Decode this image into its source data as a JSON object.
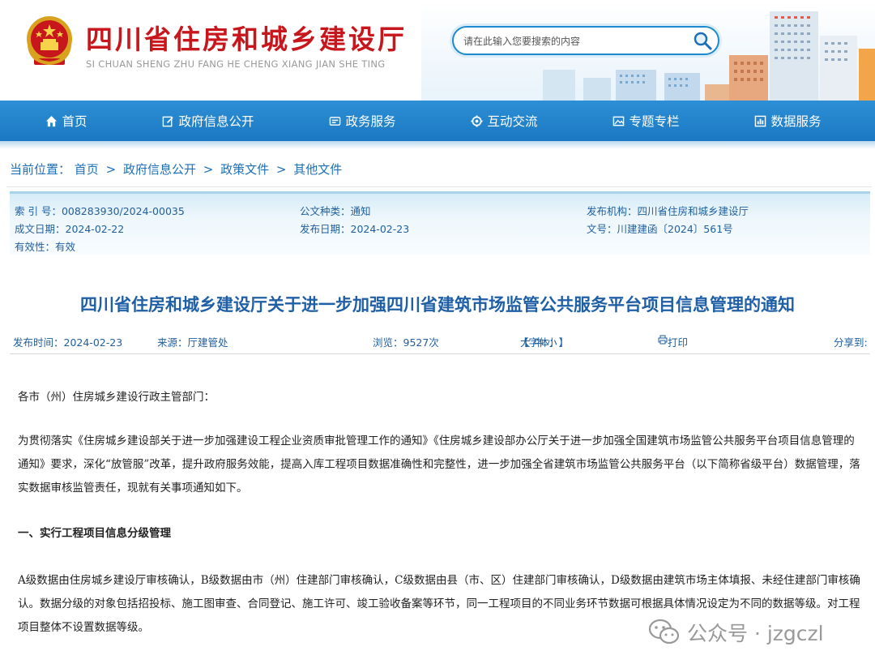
{
  "header": {
    "title": "四川省住房和城乡建设厅",
    "subtitle": "SI CHUAN SHENG ZHU FANG HE CHENG XIANG JIAN SHE TING",
    "search_placeholder": "请在此输入您要搜索的内容"
  },
  "nav": {
    "items": [
      {
        "label": "首页",
        "icon": "home-icon"
      },
      {
        "label": "政府信息公开",
        "icon": "edit-icon"
      },
      {
        "label": "政务服务",
        "icon": "service-icon"
      },
      {
        "label": "互动交流",
        "icon": "interaction-icon"
      },
      {
        "label": "专题专栏",
        "icon": "image-icon"
      },
      {
        "label": "数据服务",
        "icon": "chart-icon"
      }
    ]
  },
  "breadcrumb": {
    "prefix": "当前位置：",
    "items": [
      "首页",
      "政府信息公开",
      "政策文件",
      "其他文件"
    ],
    "separator": ">"
  },
  "meta": {
    "index_no": "索 引 号：008283930/2024-00035",
    "category": "公文种类：通知",
    "publisher": "发布机构：四川省住房和城乡建设厅",
    "created": "成文日期：2024-02-22",
    "published": "发布日期：2024-02-23",
    "doc_no": "文号：川建建函〔2024〕561号",
    "validity": "有效性：有效"
  },
  "article": {
    "title": "四川省住房和城乡建设厅关于进一步加强四川省建筑市场监管公共服务平台项目信息管理的通知",
    "pub_time": "发布时间：2024-02-23",
    "source": "来源：厅建管处",
    "views": "浏览：9527次",
    "font_prefix": "【字体：",
    "font_large": "大",
    "font_medium": "中",
    "font_small": "小",
    "font_suffix": "】",
    "print": "打印",
    "share": "分享到:",
    "salutation": "各市（州）住房城乡建设行政主管部门：",
    "para1": "为贯彻落实《住房城乡建设部关于进一步加强建设工程企业资质审批管理工作的通知》《住房城乡建设部办公厅关于进一步加强全国建筑市场监管公共服务平台项目信息管理的通知》要求，深化“放管服”改革，提升政府服务效能，提高入库工程项目数据准确性和完整性，进一步加强全省建筑市场监管公共服务平台（以下简称省级平台）数据管理，落实数据审核监管责任，现就有关事项通知如下。",
    "heading1": "一、实行工程项目信息分级管理",
    "para2": "A级数据由住房城乡建设厅审核确认，B级数据由市（州）住建部门审核确认，C级数据由县（市、区）住建部门审核确认，D级数据由建筑市场主体填报、未经住建部门审核确认。数据分级的对象包括招投标、施工图审查、合同登记、施工许可、竣工验收备案等环节，同一工程项目的不同业务环节数据可根据具体情况设定为不同的数据等级。对工程项目整体不设置数据等级。"
  },
  "watermark": {
    "text": "公众号 · jzgczl"
  },
  "colors": {
    "brand_red": "#c8161d",
    "nav_blue": "#1a78c2",
    "link_blue": "#1d6fb8"
  }
}
